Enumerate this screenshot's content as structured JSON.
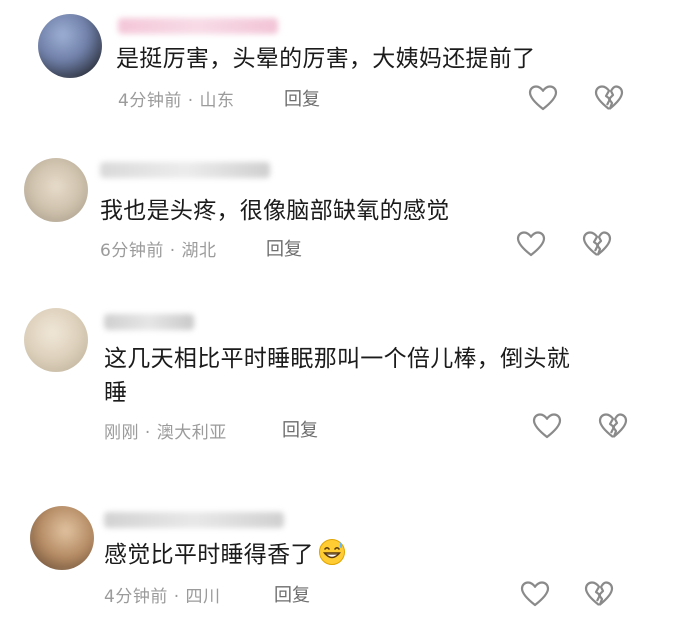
{
  "comments": [
    {
      "text": "是挺厉害，头晕的厉害，大姨妈还提前了",
      "meta": "4分钟前 · 山东",
      "reply": "回复"
    },
    {
      "text": "我也是头疼，很像脑部缺氧的感觉",
      "meta": "6分钟前 · 湖北",
      "reply": "回复"
    },
    {
      "text_line1": "这几天相比平时睡眠那叫一个倍儿棒，倒头就",
      "text_line2": "睡",
      "meta": "刚刚 · 澳大利亚",
      "reply": "回复"
    },
    {
      "text": "感觉比平时睡得香了",
      "emoji": "grinning-sweat-emoji",
      "meta": "4分钟前 · 四川",
      "reply": "回复"
    }
  ],
  "icons": {
    "like": "heart-outline-icon",
    "dislike": "broken-heart-icon"
  },
  "colors": {
    "text": "#1b1b1b",
    "meta": "#9b9b9b",
    "icon": "#8a8a8a"
  }
}
